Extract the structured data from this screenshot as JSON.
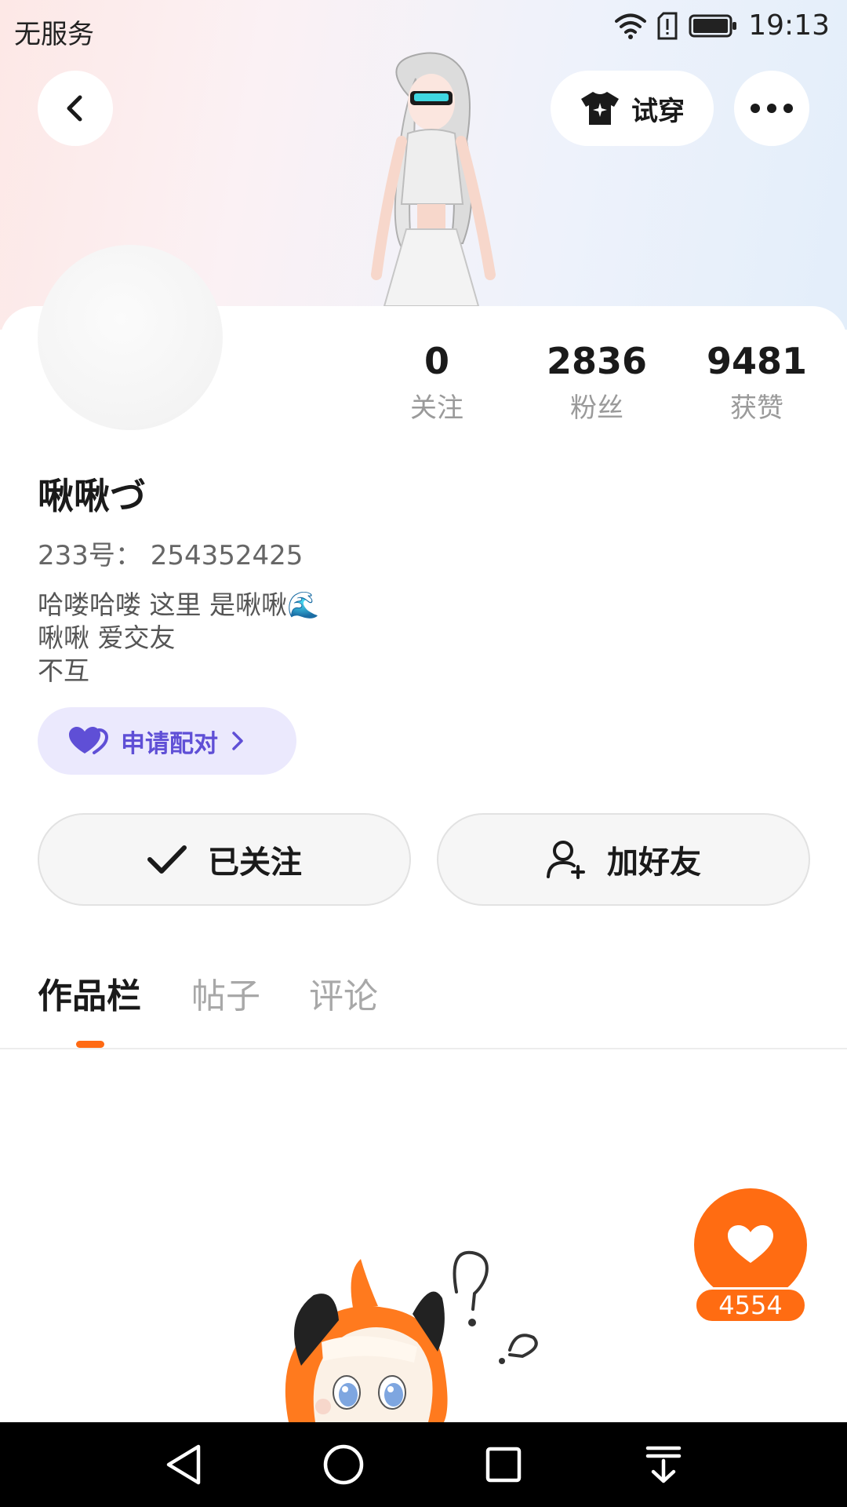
{
  "status_bar": {
    "carrier": "无服务",
    "time": "19:13",
    "icons": [
      "wifi-icon",
      "sim-alert-icon",
      "battery-icon"
    ]
  },
  "header": {
    "back_icon": "chevron-left-icon",
    "try_on_label": "试穿",
    "try_on_icon": "shirt-sparkle-icon",
    "more_icon": "more-dots-icon"
  },
  "profile": {
    "stats": [
      {
        "value": "0",
        "label": "关注"
      },
      {
        "value": "2836",
        "label": "粉丝"
      },
      {
        "value": "9481",
        "label": "获赞"
      }
    ],
    "username": "啾啾づ",
    "user_id": "233号： 254352425",
    "bio_lines": [
      "哈喽哈喽  这里 是啾啾🌊",
      "啾啾 爱交友",
      "不互"
    ],
    "pair_label": "申请配对"
  },
  "actions": {
    "follow_label": "已关注",
    "add_friend_label": "加好友"
  },
  "tabs": [
    {
      "label": "作品栏",
      "active": true
    },
    {
      "label": "帖子",
      "active": false
    },
    {
      "label": "评论",
      "active": false
    }
  ],
  "like_fab": {
    "count": "4554"
  },
  "colors": {
    "accent_orange": "#ff6c12",
    "pair_purple": "#5f4fd6",
    "pair_bg": "#ebe9fd"
  },
  "nav_bar": {
    "icons": [
      "back-triangle-icon",
      "home-circle-icon",
      "recents-square-icon",
      "notification-pull-icon"
    ]
  }
}
